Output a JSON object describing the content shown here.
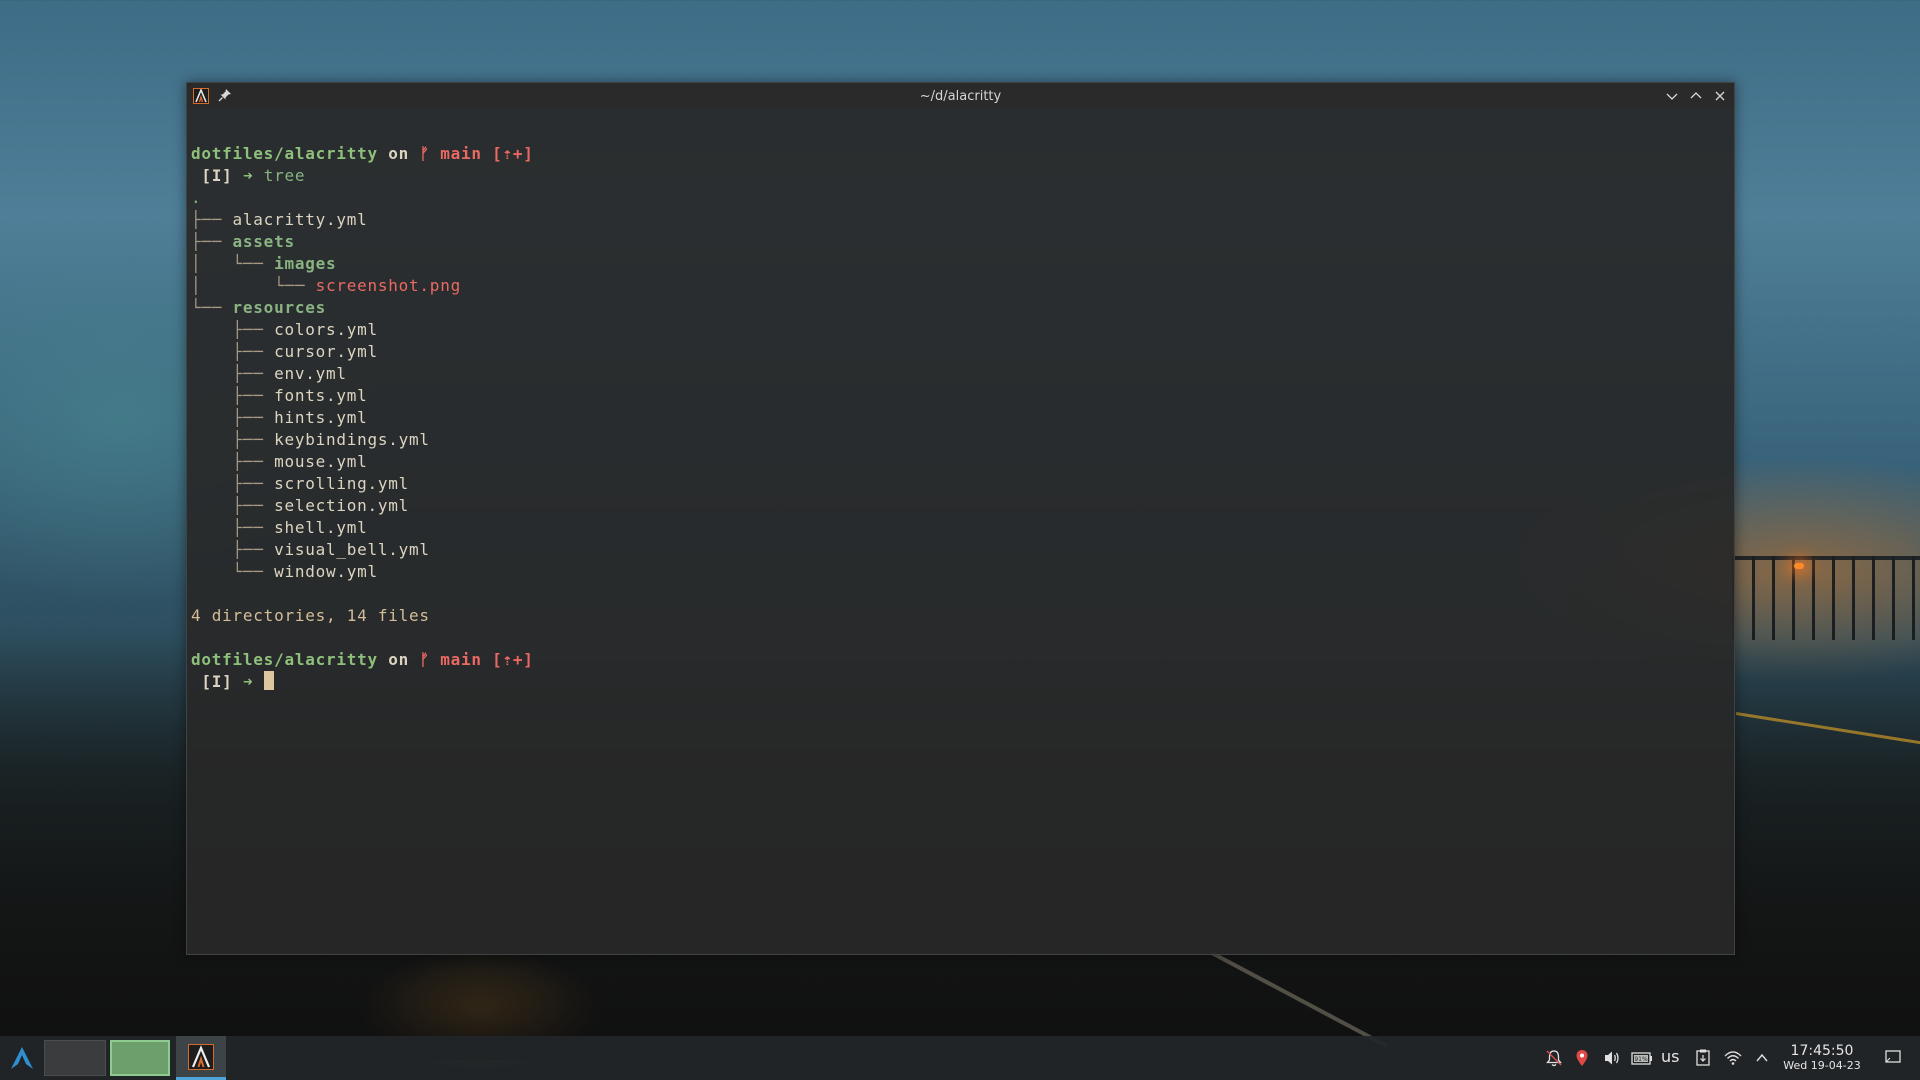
{
  "window": {
    "title": "~/d/alacritty"
  },
  "terminal": {
    "prompt_path": "dotfiles/alacritty",
    "prompt_on": "on",
    "branch_glyph": "ᚠ",
    "branch_name": "main",
    "branch_status": "[⇡+]",
    "prompt_mode": "[I]",
    "prompt_arrow": "➜",
    "command": "tree",
    "tree_root": ".",
    "tree": {
      "alacritty_yml": "alacritty.yml",
      "assets": "assets",
      "images": "images",
      "screenshot_png": "screenshot.png",
      "resources": "resources",
      "resources_files": [
        "colors.yml",
        "cursor.yml",
        "env.yml",
        "fonts.yml",
        "hints.yml",
        "keybindings.yml",
        "mouse.yml",
        "scrolling.yml",
        "selection.yml",
        "shell.yml",
        "visual_bell.yml",
        "window.yml"
      ]
    },
    "summary": "4 directories, 14 files"
  },
  "taskbar": {
    "keyboard_layout": "us",
    "time": "17:45:50",
    "date": "Wed 19-04-23",
    "battery_label": "91%"
  },
  "colors": {
    "accent": "#4fa3d8",
    "path": "#8ec07c",
    "branch": "#ea6962",
    "icon_border": "#d56a2a"
  }
}
